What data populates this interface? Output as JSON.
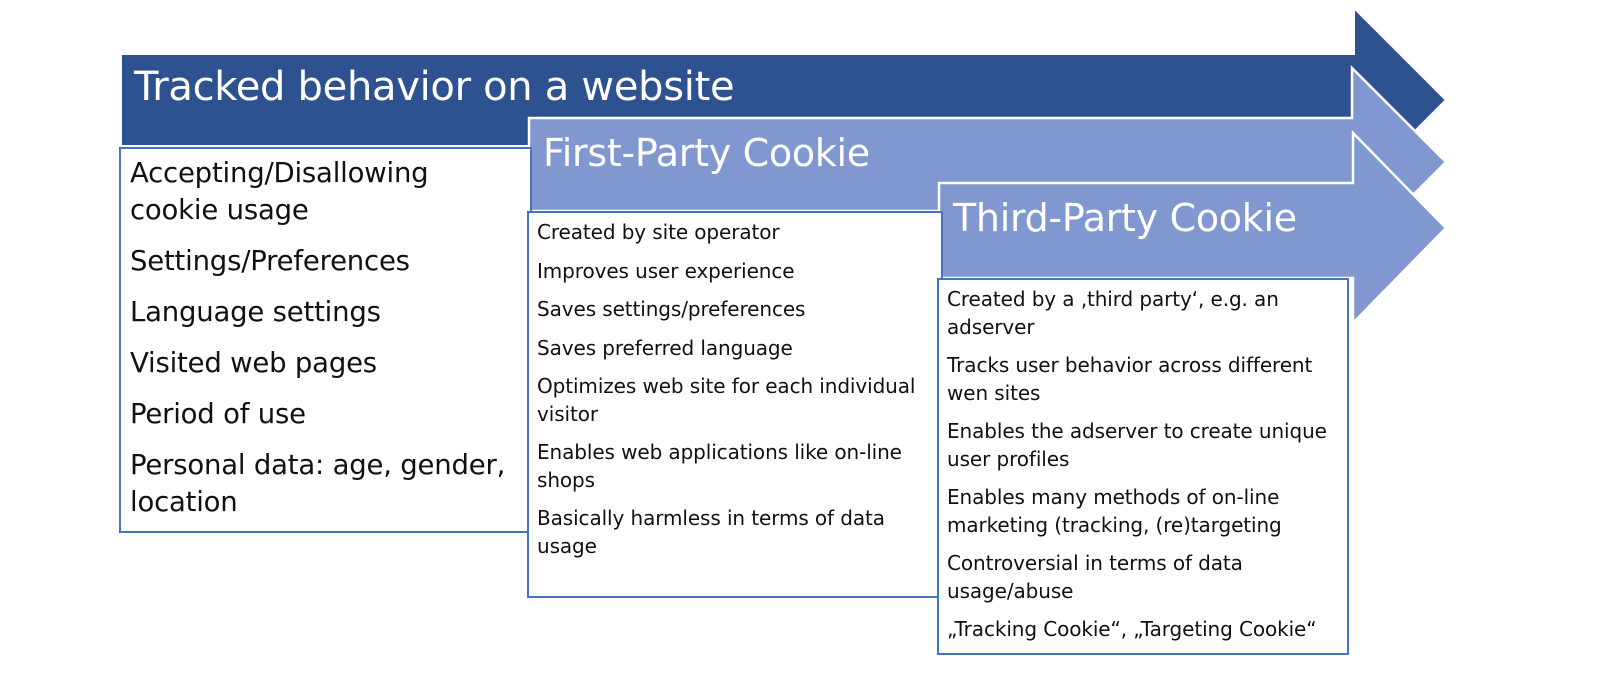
{
  "diagram": {
    "colors": {
      "dark_arrow": "#2e528f",
      "light_arrow": "#8097cf",
      "box_border": "#4472c4",
      "title_text": "#ffffff",
      "body_text": "#111111"
    },
    "stages": [
      {
        "title": "Tracked behavior on a website",
        "items": [
          "Accepting/Disallowing cookie usage",
          "Settings/Preferences",
          "Language settings",
          "Visited web pages",
          "Period of use",
          "Personal data: age, gender, location"
        ]
      },
      {
        "title": "First-Party Cookie",
        "items": [
          "Created by site operator",
          "Improves user experience",
          "Saves settings/preferences",
          "Saves preferred language",
          "Optimizes web site for each individual visitor",
          "Enables web applications like on-line shops",
          "Basically harmless in terms of data usage"
        ]
      },
      {
        "title": "Third-Party Cookie",
        "items": [
          "Created by a ‚third party‘, e.g. an adserver",
          "Tracks user behavior across different wen sites",
          "Enables the adserver to create unique user profiles",
          "Enables many methods of on-line marketing (tracking, (re)targeting",
          "Controversial in terms of data usage/abuse",
          "„Tracking Cookie“, „Targeting Cookie“"
        ]
      }
    ]
  }
}
